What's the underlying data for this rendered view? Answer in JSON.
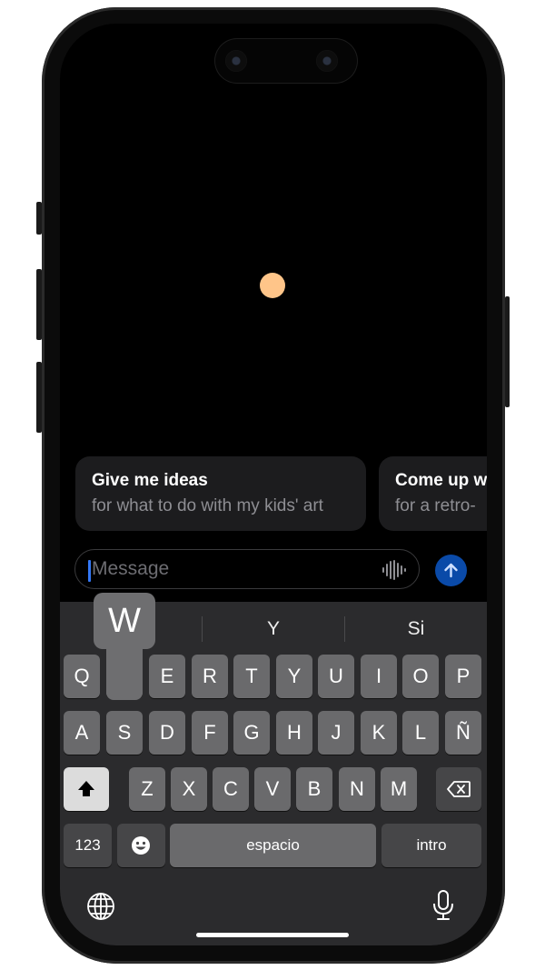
{
  "orb_color": "#ffc589",
  "cards": [
    {
      "title": "Give me ideas",
      "subtitle": "for what to do with my kids' art"
    },
    {
      "title": "Come up with",
      "subtitle": "for a retro-"
    }
  ],
  "message_bar": {
    "placeholder": "Message",
    "voice_icon": "waveform-icon",
    "send_icon": "arrow-up-icon"
  },
  "keyboard": {
    "suggestions": [
      "",
      "Y",
      "Si"
    ],
    "popup_key": "W",
    "row1": [
      "Q",
      "W",
      "E",
      "R",
      "T",
      "Y",
      "U",
      "I",
      "O",
      "P"
    ],
    "row2": [
      "A",
      "S",
      "D",
      "F",
      "G",
      "H",
      "J",
      "K",
      "L",
      "Ñ"
    ],
    "row3": [
      "Z",
      "X",
      "C",
      "V",
      "B",
      "N",
      "M"
    ],
    "numbers_label": "123",
    "space_label": "espacio",
    "return_label": "intro",
    "emoji_icon": "emoji-icon",
    "globe_icon": "globe-icon",
    "mic_icon": "microphone-icon",
    "shift_icon": "shift-icon",
    "delete_icon": "delete-icon"
  }
}
